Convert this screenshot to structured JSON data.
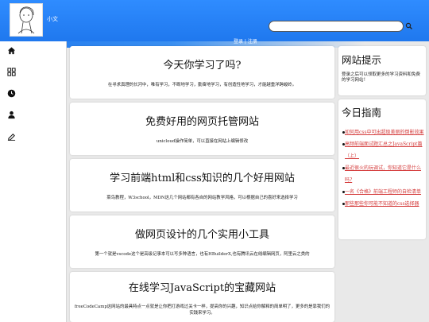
{
  "header": {
    "username": "小文",
    "login_link": "登录 | 注册",
    "search": {
      "placeholder": "",
      "value": ""
    }
  },
  "sidebar": {
    "items": [
      {
        "icon": "home-icon"
      },
      {
        "icon": "grid-icon"
      },
      {
        "icon": "clock-icon"
      },
      {
        "icon": "user-icon"
      },
      {
        "icon": "edit-icon"
      }
    ]
  },
  "main": {
    "cards": [
      {
        "title": "今天你学习了吗?",
        "desc": "在寻求真理的长河中，唯有学习，不断地学习，勤奋地学习，有创造性地学习，才能越重洋跨峻岭。"
      },
      {
        "title": "免费好用的网页托管网站",
        "desc": "unicloud操作简单，可以直接在网站上编辑修改"
      },
      {
        "title": "学习前端html和css知识的几个好用网站",
        "desc": "菜鸟教程，W3school，MDN这几个网站都有各自的网站教学风格，可以根据自己的喜好来选择学习"
      },
      {
        "title": "做网页设计的几个实用小工具",
        "desc": "第一个就是vscode这个是高级记事本可以写多种语言，也有HBuilderX,也有腾讯云在线编辑网页，阿里云之类的"
      },
      {
        "title": "在线学习JavaScript的宝藏网站",
        "desc": "freeCodeCamp这网站的最具特点一点就是让你把打游戏过关卡一样，提高你的兴趣，知识点给你解释的简单明了，更多的是靠我们的实践来学习。"
      }
    ]
  },
  "right": {
    "tips": {
      "title": "网站提示",
      "text": "登录之后可以领取更多的学习资料和免费的学习网站！"
    },
    "guide": {
      "title": "今日指南",
      "items": [
        "如何用css中可出超级美丽的倒影效果",
        "高频前端面试题汇总之JavaScript篇（上）",
        "最近很火的玩调试，你知道它是什么吗?",
        "一名《合格》前端工程师的自检清单",
        "那些那些你可能不知道的css选择器"
      ]
    }
  },
  "colors": {
    "header_blue": "#1f78ee",
    "link_red": "#d43b3b"
  }
}
